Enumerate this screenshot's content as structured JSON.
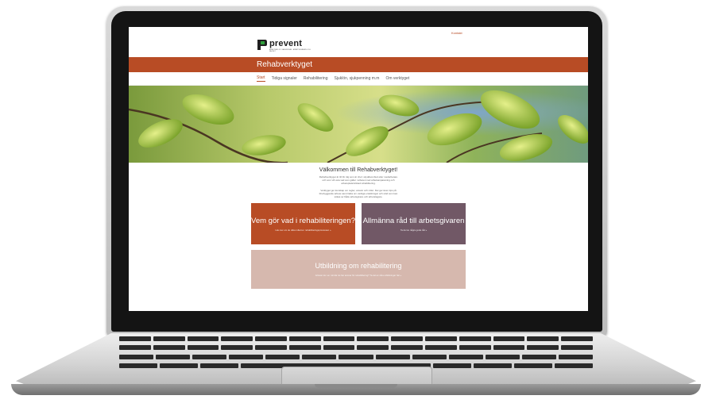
{
  "site": {
    "top_link": "Kontakt",
    "logo_text": "prevent",
    "logo_tagline": "ARBETSMILJÖ I SAMVERKAN · ARBETSGIVAREN OCH FACKET",
    "title": "Rehabverktyget"
  },
  "nav": {
    "items": [
      {
        "label": "Start"
      },
      {
        "label": "Tidiga signaler"
      },
      {
        "label": "Rehabilitering"
      },
      {
        "label": "Sjuklön, sjukpenning m.m"
      },
      {
        "label": "Om verktyget"
      }
    ]
  },
  "welcome": {
    "title": "Välkommen till Rehabverktyget!",
    "paragraph_1": "Rehabverktyget är till för dig som är chef, skyddsombud eller medarbetare och som vill veta vad som gäller i arbetet med arbetsanpassning och arbetsplatsinriktad rehabilitering.",
    "paragraph_2": "Verktyget ger kunskap om regler, ansvar och roller. Det ger även tips på förebyggande arbete samt fakta om vanliga ersättningar och stöd som kan sökas av både arbetsgivare och arbetstagare."
  },
  "cards": [
    {
      "title": "Vem gör vad i rehabiliteringen?",
      "subtitle": "Läs mer om de olika rollerna i rehabiliteringsprocessen »"
    },
    {
      "title": "Allmänna råd till arbetsgivaren",
      "subtitle": "Ta del av några goda råd »"
    },
    {
      "title": "Utbildning om rehabilitering",
      "subtitle": "Arbetar du i en roll där du har ansvar för rehabilitering? Ta del av våra utbildningar här »"
    }
  ],
  "colors": {
    "brand": "#b84c25",
    "card_purple": "#715866",
    "card_pink": "#d6b8ae",
    "logo_green": "#2e9e3a"
  }
}
